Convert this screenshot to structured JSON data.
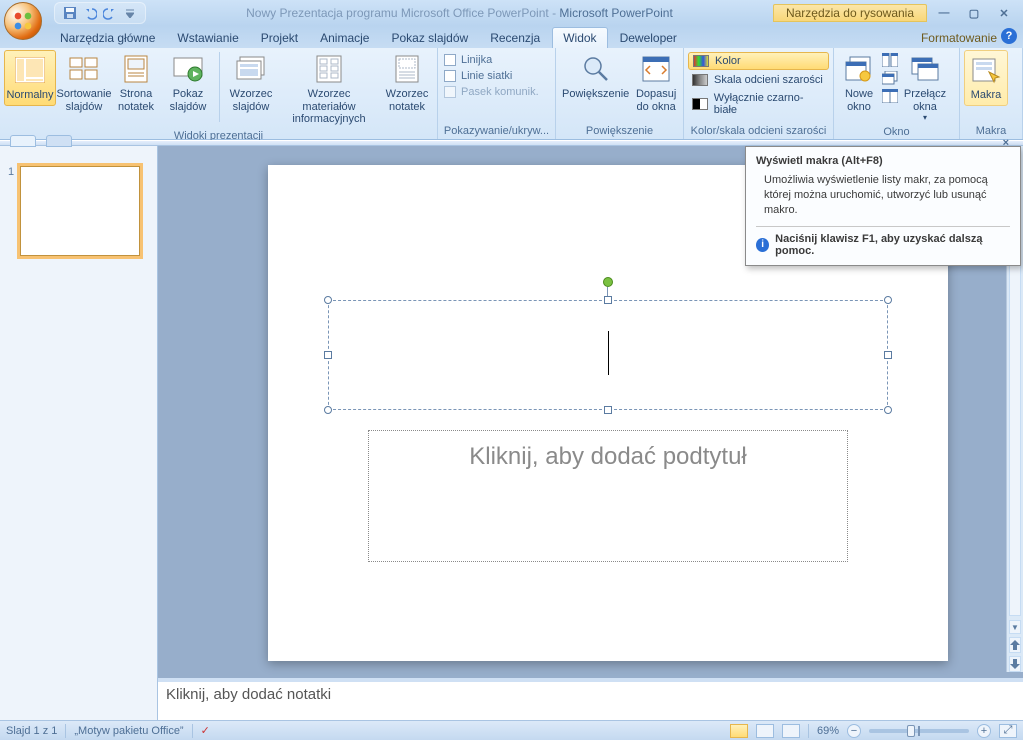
{
  "titlebar": {
    "doc_title": "Nowy Prezentacja programu Microsoft Office PowerPoint",
    "app_title": "Microsoft PowerPoint",
    "context_tools": "Narzędzia do rysowania"
  },
  "tabs": {
    "home": "Narzędzia główne",
    "insert": "Wstawianie",
    "design": "Projekt",
    "anim": "Animacje",
    "slideshow": "Pokaz slajdów",
    "review": "Recenzja",
    "view": "Widok",
    "developer": "Deweloper",
    "format": "Formatowanie"
  },
  "ribbon": {
    "views_group": "Widoki prezentacji",
    "normal": "Normalny",
    "sorter": "Sortowanie slajdów",
    "notes_page": "Strona notatek",
    "slideshow": "Pokaz slajdów",
    "slide_master": "Wzorzec slajdów",
    "handout_master": "Wzorzec materiałów informacyjnych",
    "notes_master": "Wzorzec notatek",
    "showhide_group": "Pokazywanie/ukryw...",
    "ruler": "Linijka",
    "gridlines": "Linie siatki",
    "messagebar": "Pasek komunik.",
    "zoom_group": "Powiększenie",
    "zoom": "Powiększenie",
    "fit": "Dopasuj do okna",
    "color_group": "Kolor/skala odcieni szarości",
    "color": "Kolor",
    "grayscale": "Skala odcieni szarości",
    "bw": "Wyłącznie czarno-białe",
    "window_group": "Okno",
    "new_window": "Nowe okno",
    "arrange": "",
    "cascade": "",
    "switch": "Przełącz okna",
    "macros_group": "Makra",
    "macros": "Makra"
  },
  "tooltip": {
    "title": "Wyświetl makra (Alt+F8)",
    "body": "Umożliwia wyświetlenie listy makr, za pomocą której można uruchomić, utworzyć lub usunąć makro.",
    "f1": "Naciśnij klawisz F1, aby uzyskać dalszą pomoc."
  },
  "slide": {
    "subtitle_placeholder": "Kliknij, aby dodać podtytuł",
    "notes_placeholder": "Kliknij, aby dodać notatki",
    "thumb_number": "1"
  },
  "status": {
    "slide_pos": "Slajd 1 z 1",
    "theme": "„Motyw pakietu Office”",
    "zoom": "69%"
  }
}
